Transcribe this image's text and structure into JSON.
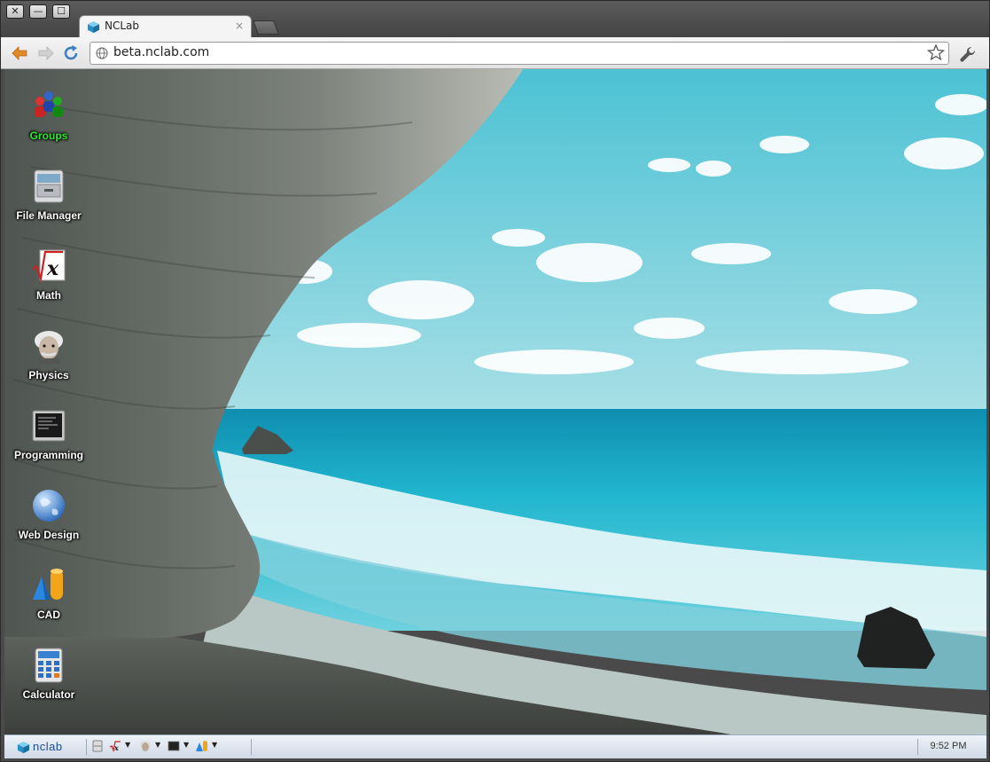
{
  "window": {
    "controls": {
      "close": "close-icon",
      "minimize": "minimize-icon",
      "maximize": "maximize-icon"
    }
  },
  "tab": {
    "title": "NCLab",
    "favicon": "nclab-cube-icon",
    "close": "×"
  },
  "toolbar": {
    "back_icon": "back-arrow-icon",
    "forward_icon": "forward-arrow-icon",
    "reload_icon": "reload-icon",
    "url": "beta.nclab.com",
    "bookmark_icon": "star-icon",
    "menu_icon": "wrench-icon"
  },
  "desktop": {
    "icons": [
      {
        "label": "Groups",
        "icon": "groups-icon",
        "highlight": true
      },
      {
        "label": "File Manager",
        "icon": "file-cabinet-icon"
      },
      {
        "label": "Math",
        "icon": "sqrt-x-icon"
      },
      {
        "label": "Physics",
        "icon": "einstein-icon"
      },
      {
        "label": "Programming",
        "icon": "terminal-icon"
      },
      {
        "label": "Web Design",
        "icon": "globe-icon"
      },
      {
        "label": "CAD",
        "icon": "shapes-icon"
      },
      {
        "label": "Calculator",
        "icon": "calculator-icon"
      }
    ]
  },
  "taskbar": {
    "brand": "nclab",
    "items": [
      "file-cabinet-icon",
      "sqrt-x-icon",
      "einstein-icon",
      "terminal-icon",
      "shapes-icon"
    ],
    "clock": "9:52 PM"
  },
  "colors": {
    "highlight_label": "#2ee82e",
    "link_blue": "#1f4d8f"
  }
}
